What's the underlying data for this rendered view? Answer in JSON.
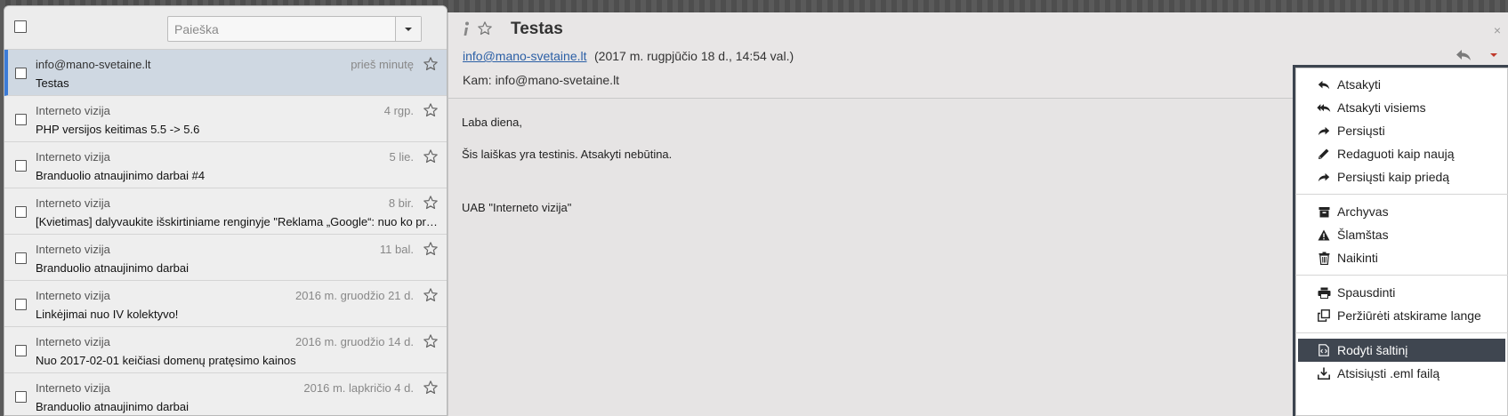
{
  "search": {
    "placeholder": "Paieška"
  },
  "messages": [
    {
      "sender": "info@mano-svetaine.lt",
      "date": "prieš minutę",
      "subject": "Testas"
    },
    {
      "sender": "Interneto vizija",
      "date": "4 rgp.",
      "subject": "PHP versijos keitimas 5.5 -> 5.6"
    },
    {
      "sender": "Interneto vizija",
      "date": "5 lie.",
      "subject": "Branduolio atnaujinimo darbai #4"
    },
    {
      "sender": "Interneto vizija",
      "date": "8 bir.",
      "subject": "[Kvietimas] dalyvaukite išskirtiniame renginyje \"Reklama „Google“: nuo ko pradėti\""
    },
    {
      "sender": "Interneto vizija",
      "date": "11 bal.",
      "subject": "Branduolio atnaujinimo darbai"
    },
    {
      "sender": "Interneto vizija",
      "date": "2016 m. gruodžio 21 d.",
      "subject": "Linkėjimai nuo IV kolektyvo!"
    },
    {
      "sender": "Interneto vizija",
      "date": "2016 m. gruodžio 14 d.",
      "subject": "Nuo 2017-02-01 keičiasi domenų pratęsimo kainos"
    },
    {
      "sender": "Interneto vizija",
      "date": "2016 m. lapkričio 4 d.",
      "subject": "Branduolio atnaujinimo darbai"
    }
  ],
  "mail": {
    "subject": "Testas",
    "from": "info@mano-svetaine.lt",
    "date": "(2017 m. rugpjūčio 18 d., 14:54 val.)",
    "to": "Kam: info@mano-svetaine.lt",
    "close": "×",
    "body": {
      "line1": "Laba diena,",
      "line2": "Šis laiškas yra testinis. Atsakyti nebūtina.",
      "line3": "UAB \"Interneto vizija\""
    }
  },
  "menu": {
    "reply": "Atsakyti",
    "reply_all": "Atsakyti visiems",
    "forward": "Persiųsti",
    "edit_new": "Redaguoti kaip naują",
    "forward_attach": "Persiųsti kaip priedą",
    "archive": "Archyvas",
    "spam": "Šlamštas",
    "delete": "Naikinti",
    "print": "Spausdinti",
    "open_window": "Peržiūrėti atskirame lange",
    "show_source": "Rodyti šaltinį",
    "download_eml": "Atsisiųsti .eml failą"
  },
  "colors": {
    "accent": "#3b7bd8",
    "selected_row": "#cfd8e2",
    "menu_highlight": "#3f4650",
    "link": "#2b5fa5"
  }
}
